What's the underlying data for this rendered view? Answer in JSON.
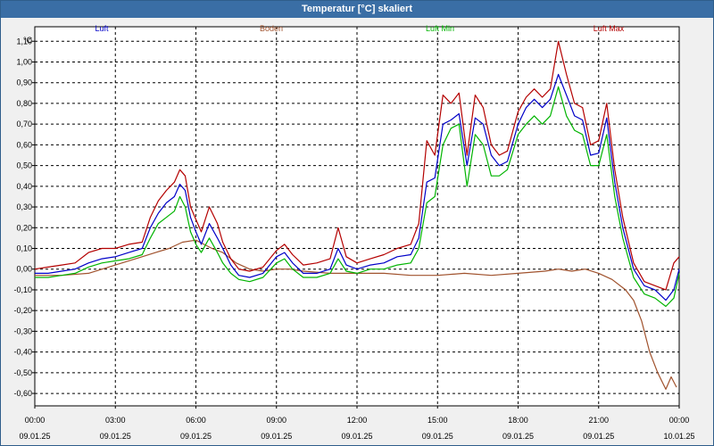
{
  "window": {
    "title": "Temperatur [°C] skaliert"
  },
  "chart_data": {
    "type": "line",
    "title": "Temperatur [°C] skaliert",
    "ylabel": "°C",
    "xlabel": "",
    "grid": true,
    "legend_placement": "top",
    "ylim": [
      -0.66,
      1.17
    ],
    "yticks": [
      1.1,
      1.0,
      0.9,
      0.8,
      0.7,
      0.6,
      0.5,
      0.4,
      0.3,
      0.2,
      0.1,
      0.0,
      -0.1,
      -0.2,
      -0.3,
      -0.4,
      -0.5,
      -0.6
    ],
    "ytick_labels": [
      "1,10",
      "1,00",
      "0,90",
      "0,80",
      "0,70",
      "0,60",
      "0,50",
      "0,40",
      "0,30",
      "0,20",
      "0,10",
      "0,00",
      "-0,10",
      "-0,20",
      "-0,30",
      "-0,40",
      "-0,50",
      "-0,60"
    ],
    "xlim": [
      0,
      24
    ],
    "xticks": [
      {
        "hour": 0,
        "time": "00:00",
        "date": "09.01.25"
      },
      {
        "hour": 3,
        "time": "03:00",
        "date": "09.01.25"
      },
      {
        "hour": 6,
        "time": "06:00",
        "date": "09.01.25"
      },
      {
        "hour": 9,
        "time": "09:00",
        "date": "09.01.25"
      },
      {
        "hour": 12,
        "time": "12:00",
        "date": "09.01.25"
      },
      {
        "hour": 15,
        "time": "15:00",
        "date": "09.01.25"
      },
      {
        "hour": 18,
        "time": "18:00",
        "date": "09.01.25"
      },
      {
        "hour": 21,
        "time": "21:00",
        "date": "09.01.25"
      },
      {
        "hour": 24,
        "time": "00:00",
        "date": "10.01.25"
      }
    ],
    "series": [
      {
        "name": "Luft",
        "color": "#0000c8",
        "x": [
          0,
          0.5,
          1,
          1.5,
          2,
          2.5,
          3,
          3.5,
          4,
          4.3,
          4.6,
          4.9,
          5.2,
          5.4,
          5.6,
          5.8,
          6,
          6.2,
          6.5,
          6.8,
          7,
          7.3,
          7.6,
          8,
          8.5,
          9,
          9.3,
          9.6,
          10,
          10.5,
          11,
          11.3,
          11.6,
          12,
          12.5,
          13,
          13.5,
          14,
          14.3,
          14.6,
          14.9,
          15.2,
          15.5,
          15.8,
          16.1,
          16.4,
          16.7,
          17,
          17.3,
          17.6,
          18,
          18.3,
          18.6,
          18.9,
          19.2,
          19.5,
          19.8,
          20.1,
          20.4,
          20.7,
          21,
          21.3,
          21.6,
          21.9,
          22.3,
          22.7,
          23.1,
          23.5,
          23.8,
          24
        ],
        "values": [
          -0.02,
          -0.02,
          -0.01,
          0.0,
          0.03,
          0.05,
          0.06,
          0.08,
          0.1,
          0.2,
          0.27,
          0.32,
          0.35,
          0.41,
          0.38,
          0.25,
          0.18,
          0.12,
          0.22,
          0.15,
          0.1,
          0.02,
          -0.03,
          -0.04,
          -0.02,
          0.06,
          0.08,
          0.03,
          -0.02,
          -0.02,
          0.0,
          0.1,
          0.02,
          0.0,
          0.02,
          0.03,
          0.06,
          0.07,
          0.15,
          0.42,
          0.44,
          0.7,
          0.72,
          0.75,
          0.5,
          0.73,
          0.7,
          0.55,
          0.5,
          0.52,
          0.7,
          0.78,
          0.82,
          0.78,
          0.82,
          0.94,
          0.84,
          0.74,
          0.72,
          0.55,
          0.56,
          0.73,
          0.42,
          0.2,
          0.0,
          -0.08,
          -0.1,
          -0.15,
          -0.1,
          0.0
        ]
      },
      {
        "name": "Boden",
        "color": "#a0522d",
        "x": [
          0,
          1,
          2,
          3,
          3.5,
          4,
          4.5,
          5,
          5.5,
          6,
          6.3,
          6.6,
          7,
          7.5,
          8,
          8.5,
          9,
          9.5,
          10,
          11,
          12,
          13,
          14,
          15,
          16,
          17,
          18,
          19,
          19.5,
          20,
          20.5,
          21,
          21.5,
          22,
          22.3,
          22.6,
          22.9,
          23.2,
          23.5,
          23.7,
          23.9
        ],
        "values": [
          -0.03,
          -0.03,
          -0.02,
          0.02,
          0.04,
          0.06,
          0.08,
          0.1,
          0.13,
          0.14,
          0.12,
          0.1,
          0.08,
          0.03,
          0.0,
          -0.01,
          0.0,
          0.0,
          -0.01,
          -0.02,
          -0.02,
          -0.02,
          -0.03,
          -0.03,
          -0.02,
          -0.03,
          -0.02,
          -0.01,
          0.0,
          -0.01,
          0.0,
          -0.02,
          -0.05,
          -0.1,
          -0.15,
          -0.25,
          -0.4,
          -0.5,
          -0.58,
          -0.52,
          -0.57
        ]
      },
      {
        "name": "Luft Min",
        "color": "#00b400",
        "x": [
          0,
          0.5,
          1,
          1.5,
          2,
          2.5,
          3,
          3.5,
          4,
          4.3,
          4.6,
          4.9,
          5.2,
          5.4,
          5.6,
          5.8,
          6,
          6.2,
          6.5,
          6.8,
          7,
          7.3,
          7.6,
          8,
          8.5,
          9,
          9.3,
          9.6,
          10,
          10.5,
          11,
          11.3,
          11.6,
          12,
          12.5,
          13,
          13.5,
          14,
          14.3,
          14.6,
          14.9,
          15.2,
          15.5,
          15.8,
          16.1,
          16.4,
          16.7,
          17,
          17.3,
          17.6,
          18,
          18.3,
          18.6,
          18.9,
          19.2,
          19.5,
          19.8,
          20.1,
          20.4,
          20.7,
          21,
          21.3,
          21.6,
          21.9,
          22.3,
          22.7,
          23.1,
          23.5,
          23.8,
          24
        ],
        "values": [
          -0.04,
          -0.04,
          -0.03,
          -0.02,
          0.01,
          0.03,
          0.04,
          0.05,
          0.07,
          0.15,
          0.22,
          0.25,
          0.28,
          0.35,
          0.3,
          0.18,
          0.12,
          0.08,
          0.15,
          0.08,
          0.03,
          -0.02,
          -0.05,
          -0.06,
          -0.04,
          0.03,
          0.05,
          0.0,
          -0.04,
          -0.04,
          -0.02,
          0.05,
          -0.01,
          -0.02,
          0.0,
          0.0,
          0.02,
          0.03,
          0.1,
          0.32,
          0.35,
          0.6,
          0.68,
          0.7,
          0.4,
          0.65,
          0.6,
          0.45,
          0.45,
          0.48,
          0.65,
          0.7,
          0.74,
          0.7,
          0.74,
          0.88,
          0.74,
          0.67,
          0.65,
          0.5,
          0.5,
          0.65,
          0.35,
          0.15,
          -0.04,
          -0.12,
          -0.14,
          -0.18,
          -0.14,
          -0.02
        ]
      },
      {
        "name": "Luft Max",
        "color": "#b40000",
        "x": [
          0,
          0.5,
          1,
          1.5,
          2,
          2.5,
          3,
          3.5,
          4,
          4.3,
          4.6,
          4.9,
          5.2,
          5.4,
          5.6,
          5.8,
          6,
          6.2,
          6.5,
          6.8,
          7,
          7.3,
          7.6,
          8,
          8.5,
          9,
          9.3,
          9.6,
          10,
          10.5,
          11,
          11.3,
          11.6,
          12,
          12.5,
          13,
          13.5,
          14,
          14.3,
          14.6,
          14.9,
          15.2,
          15.5,
          15.8,
          16.1,
          16.4,
          16.7,
          17,
          17.3,
          17.6,
          18,
          18.3,
          18.6,
          18.9,
          19.2,
          19.5,
          19.8,
          20.1,
          20.4,
          20.7,
          21,
          21.3,
          21.6,
          21.9,
          22.3,
          22.7,
          23.1,
          23.5,
          23.8,
          24
        ],
        "values": [
          0.0,
          0.01,
          0.02,
          0.03,
          0.08,
          0.1,
          0.1,
          0.12,
          0.13,
          0.25,
          0.33,
          0.38,
          0.42,
          0.48,
          0.45,
          0.3,
          0.24,
          0.18,
          0.3,
          0.22,
          0.13,
          0.05,
          0.0,
          -0.01,
          0.01,
          0.09,
          0.12,
          0.07,
          0.02,
          0.03,
          0.05,
          0.2,
          0.06,
          0.03,
          0.05,
          0.07,
          0.1,
          0.12,
          0.22,
          0.62,
          0.55,
          0.84,
          0.8,
          0.85,
          0.55,
          0.84,
          0.78,
          0.6,
          0.55,
          0.57,
          0.76,
          0.83,
          0.87,
          0.83,
          0.87,
          1.1,
          0.94,
          0.8,
          0.78,
          0.6,
          0.62,
          0.8,
          0.48,
          0.25,
          0.03,
          -0.06,
          -0.08,
          -0.1,
          0.03,
          0.06
        ]
      }
    ]
  }
}
